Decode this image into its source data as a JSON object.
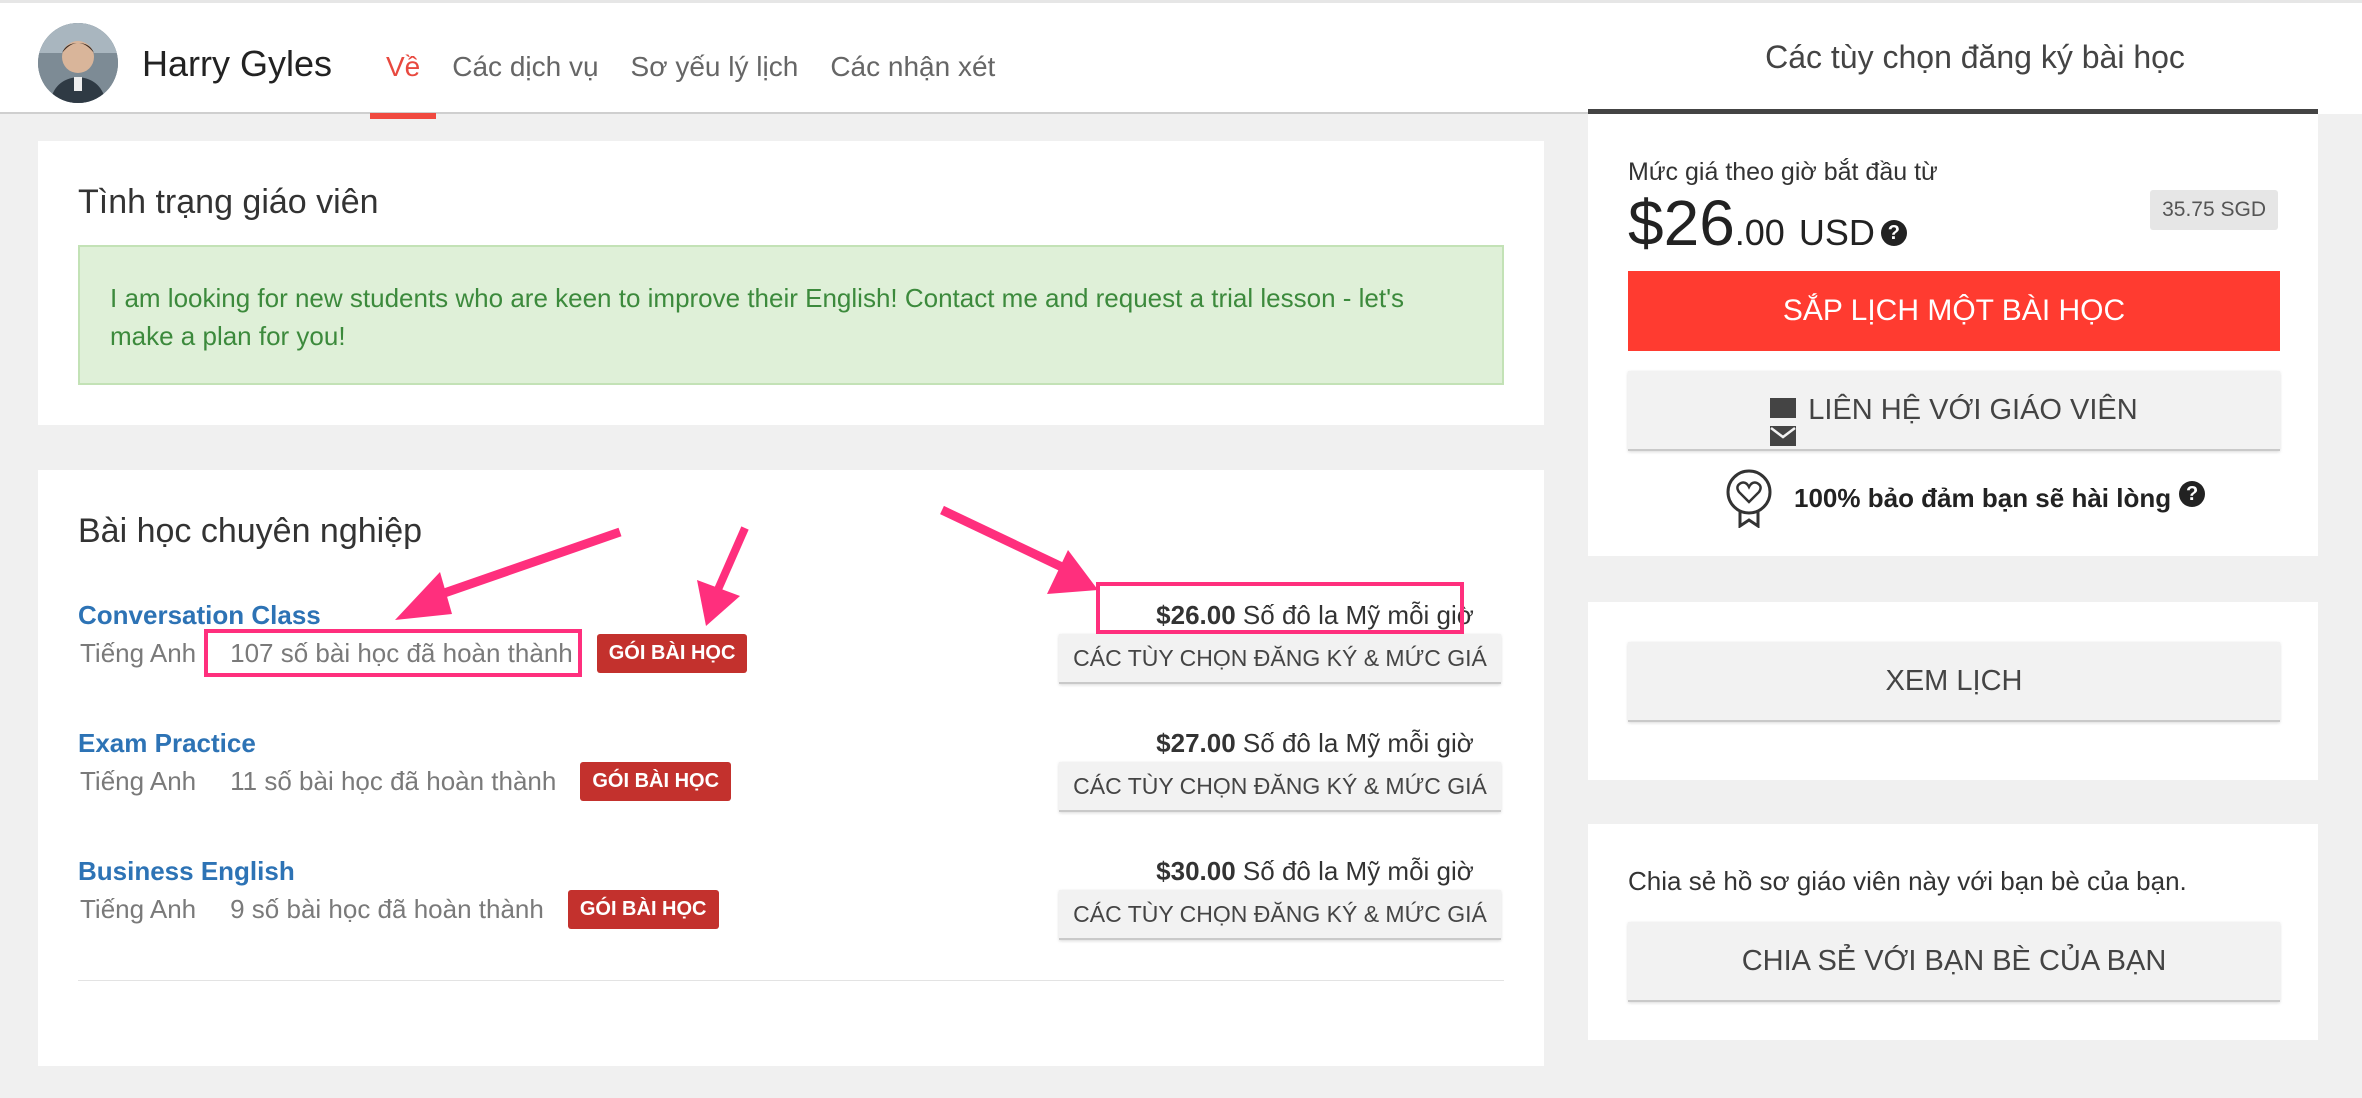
{
  "teacher": {
    "name": "Harry Gyles"
  },
  "tabs": [
    {
      "label": "Về"
    },
    {
      "label": "Các dịch vụ"
    },
    {
      "label": "Sơ yếu lý lịch"
    },
    {
      "label": "Các nhận xét"
    }
  ],
  "sidebar_header": {
    "title": "Các tùy chọn đăng ký bài học"
  },
  "status": {
    "title": "Tình trạng giáo viên",
    "message": "I am looking for new students who are keen to improve their English! Contact me and request a trial lesson - let's make a plan for you!"
  },
  "lessons": {
    "title": "Bài học chuyên nghiệp",
    "items": [
      {
        "name": "Conversation Class",
        "language": "Tiếng Anh",
        "completed": "107 số bài học đã hoàn thành",
        "package": "GÓI BÀI HỌC",
        "price": "$26.00",
        "price_unit": "Số đô la Mỹ mỗi giờ",
        "options": "CÁC TÙY CHỌN ĐĂNG KÝ & MỨC GIÁ"
      },
      {
        "name": "Exam Practice",
        "language": "Tiếng Anh",
        "completed": "11 số bài học đã hoàn thành",
        "package": "GÓI BÀI HỌC",
        "price": "$27.00",
        "price_unit": "Số đô la Mỹ mỗi giờ",
        "options": "CÁC TÙY CHỌN ĐĂNG KÝ & MỨC GIÁ"
      },
      {
        "name": "Business English",
        "language": "Tiếng Anh",
        "completed": "9 số bài học đã hoàn thành",
        "package": "GÓI BÀI HỌC",
        "price": "$30.00",
        "price_unit": "Số đô la Mỹ mỗi giờ",
        "options": "CÁC TÙY CHỌN ĐĂNG KÝ & MỨC GIÁ"
      }
    ]
  },
  "pricing": {
    "caption": "Mức giá theo giờ bắt đầu từ",
    "dollars": "$26",
    "cents": ".00",
    "currency": "USD",
    "alt_price": "35.75 SGD",
    "book_label": "SẮP LỊCH MỘT BÀI HỌC",
    "contact_label": "LIÊN HỆ VỚI GIÁO VIÊN",
    "guarantee": "100% bảo đảm bạn sẽ hài lòng"
  },
  "schedule": {
    "label": "XEM LỊCH"
  },
  "share": {
    "text": "Chia sẻ hồ sơ giáo viên này với bạn bè của bạn.",
    "label": "CHIA SẺ VỚI BẠN BÈ CỦA BẠN"
  },
  "icons": {
    "help": "?",
    "mail": "mail-icon",
    "guarantee": "heart-ribbon-icon"
  },
  "colors": {
    "accent": "#ff3b30",
    "link": "#2d73b5",
    "badge": "#c3312d",
    "annotation": "#ff2f7d",
    "status_bg": "#dff0d8"
  }
}
